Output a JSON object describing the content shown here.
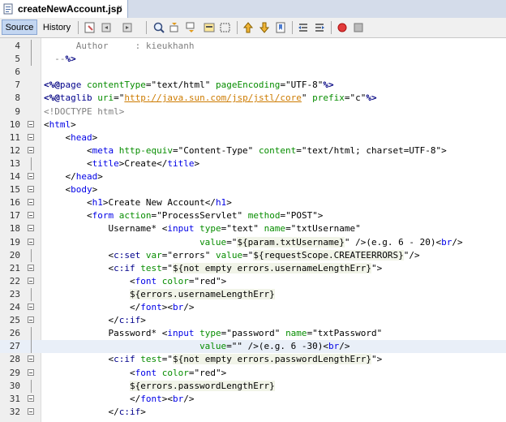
{
  "tab": {
    "title": "createNewAccount.jsp",
    "close": "×"
  },
  "toolbar": {
    "source": "Source",
    "history": "History"
  },
  "lines": [
    {
      "n": "4",
      "code": "      Author     : kieukhanh"
    },
    {
      "n": "5",
      "code": "  --%>"
    },
    {
      "n": "6",
      "code": ""
    },
    {
      "n": "7",
      "code": "<%@page contentType=\"text/html\" pageEncoding=\"UTF-8\"%>"
    },
    {
      "n": "8",
      "code": "<%@taglib uri=\"http://java.sun.com/jsp/jstl/core\" prefix=\"c\"%>"
    },
    {
      "n": "9",
      "code": "<!DOCTYPE html>"
    },
    {
      "n": "10",
      "code": "<html>"
    },
    {
      "n": "11",
      "code": "    <head>"
    },
    {
      "n": "12",
      "code": "        <meta http-equiv=\"Content-Type\" content=\"text/html; charset=UTF-8\">"
    },
    {
      "n": "13",
      "code": "        <title>Create</title>"
    },
    {
      "n": "14",
      "code": "    </head>"
    },
    {
      "n": "15",
      "code": "    <body>"
    },
    {
      "n": "16",
      "code": "        <h1>Create New Account</h1>"
    },
    {
      "n": "17",
      "code": "        <form action=\"ProcessServlet\" method=\"POST\">"
    },
    {
      "n": "18",
      "code": "            Username* <input type=\"text\" name=\"txtUsername\""
    },
    {
      "n": "19",
      "code": "                             value=\"${param.txtUsername}\" />(e.g. 6 - 20)<br/>"
    },
    {
      "n": "20",
      "code": "            <c:set var=\"errors\" value=\"${requestScope.CREATEERRORS}\"/>"
    },
    {
      "n": "21",
      "code": "            <c:if test=\"${not empty errors.usernameLengthErr}\">"
    },
    {
      "n": "22",
      "code": "                <font color=\"red\">"
    },
    {
      "n": "23",
      "code": "                ${errors.usernameLengthErr}"
    },
    {
      "n": "24",
      "code": "                </font><br/>"
    },
    {
      "n": "25",
      "code": "            </c:if>"
    },
    {
      "n": "26",
      "code": "            Password* <input type=\"password\" name=\"txtPassword\""
    },
    {
      "n": "27",
      "code": "                             value=\"\" />(e.g. 6 -30)<br/>"
    },
    {
      "n": "28",
      "code": "            <c:if test=\"${not empty errors.passwordLengthErr}\">"
    },
    {
      "n": "29",
      "code": "                <font color=\"red\">"
    },
    {
      "n": "30",
      "code": "                ${errors.passwordLengthErr}"
    },
    {
      "n": "31",
      "code": "                </font><br/>"
    },
    {
      "n": "32",
      "code": "            </c:if>"
    }
  ]
}
